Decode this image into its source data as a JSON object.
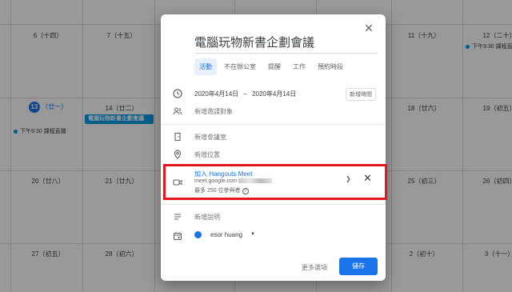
{
  "calendar": {
    "days": [
      {
        "label": "6（十四）"
      },
      {
        "label": "7（十五）"
      },
      {
        "label": "11（十九）"
      },
      {
        "label": "12（二十）"
      },
      {
        "num": "13",
        "lunar": "（廿一）"
      },
      {
        "label": "14（廿二）"
      },
      {
        "label": "18（廿六）"
      },
      {
        "label": "19（初五）"
      },
      {
        "label": "20（廿八）"
      },
      {
        "label": "21（廿九）"
      },
      {
        "label": "25（初三）"
      },
      {
        "label": "26（初四）"
      },
      {
        "label": "27（初五）"
      },
      {
        "label": "28（初六）"
      },
      {
        "label": "2（初十）"
      },
      {
        "label": "3（十一）"
      }
    ],
    "events": {
      "day12": "下午9:30 課程直播",
      "day13": "下午9:30 課程直播",
      "new_chip": "電腦玩物新書企劃會議"
    },
    "accent": "#1a73e8",
    "event_color": "#039be5"
  },
  "dialog": {
    "title": "電腦玩物新書企劃會議",
    "tabs": [
      "活動",
      "不在辦公室",
      "提醒",
      "工作",
      "預約時段"
    ],
    "date_start": "2020年4月14日",
    "date_sep": "–",
    "date_end": "2020年4月14日",
    "add_time": "新增時間",
    "add_guests": "新增邀請對象",
    "add_room": "新增會議室",
    "add_location": "新增位置",
    "meet": {
      "title": "加入 Hangouts Meet",
      "url": "meet.google.com",
      "max": "最多 250 位參與者"
    },
    "add_description": "新增說明",
    "owner": "esor huang",
    "more_options": "更多選項",
    "save": "儲存",
    "highlight_color": "#e5151c"
  }
}
